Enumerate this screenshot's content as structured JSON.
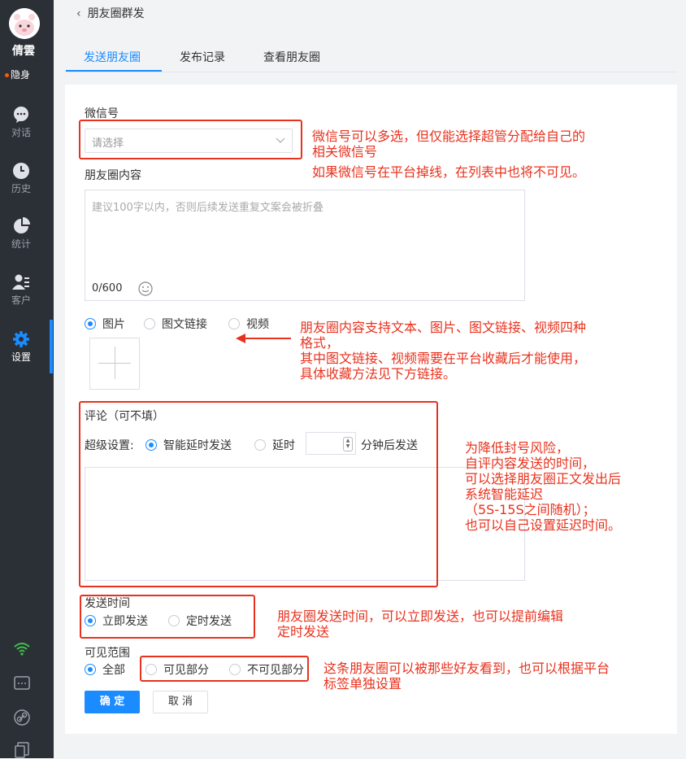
{
  "sidebar": {
    "user_name": "倩雲",
    "status": "隐身",
    "nav": [
      {
        "label": "对话",
        "icon": "chat-icon"
      },
      {
        "label": "历史",
        "icon": "clock-icon"
      },
      {
        "label": "统计",
        "icon": "pie-chart-icon"
      },
      {
        "label": "客户",
        "icon": "customer-icon"
      },
      {
        "label": "设置",
        "icon": "gear-icon"
      }
    ]
  },
  "header": {
    "back_title": "朋友圈群发"
  },
  "tabs": [
    "发送朋友圈",
    "发布记录",
    "查看朋友圈"
  ],
  "form": {
    "wechat_label": "微信号",
    "wechat_placeholder": "请选择",
    "content_label": "朋友圈内容",
    "content_placeholder": "建议100字以内，否则后续发送重复文案会被折叠",
    "counter_current": "0",
    "counter_max": "/600",
    "media_options": [
      "图片",
      "图文链接",
      "视频"
    ],
    "comment_label": "评论（可不填）",
    "super_label": "超级设置:",
    "smart_delay": "智能延时发送",
    "delay": "延时",
    "minutes_after": "分钟后发送",
    "send_time_label": "发送时间",
    "send_now": "立即发送",
    "send_scheduled": "定时发送",
    "visible_label": "可见范围",
    "visible_all": "全部",
    "visible_partial": "可见部分",
    "invisible_partial": "不可见部分",
    "ok": "确 定",
    "cancel": "取 消"
  },
  "notes": {
    "wechat": "微信号可以多选，但仅能选择超管分配给自己的\n相关微信号",
    "wechat_offline": "如果微信号在平台掉线，在列表中也将不可见。",
    "content": "朋友圈内容支持文本、图片、图文链接、视频四种\n格式，\n其中图文链接、视频需要在平台收藏后才能使用，\n具体收藏方法见下方链接。",
    "comment": "为降低封号风险，\n自评内容发送的时间，\n可以选择朋友圈正文发出后\n系统智能延迟\n（5S-15S之间随机）；\n也可以自己设置延迟时间。",
    "send_time": "朋友圈发送时间，可以立即发送，也可以提前编辑\n定时发送",
    "visible": "这条朋友圈可以被那些好友看到，也可以根据平台\n标签单独设置"
  },
  "colors": {
    "accent": "#1a8cff",
    "annotation": "#e8321e",
    "sidebar": "#2b2f36"
  }
}
